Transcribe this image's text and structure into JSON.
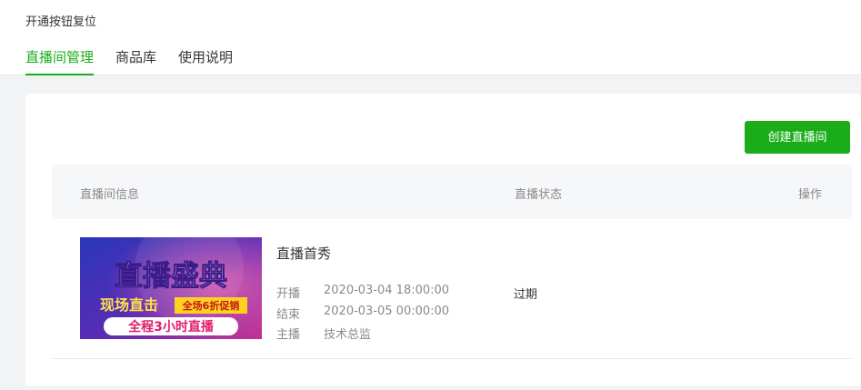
{
  "header": {
    "reset_label": "开通按钮复位",
    "tabs": [
      {
        "label": "直播间管理",
        "active": true
      },
      {
        "label": "商品库",
        "active": false
      },
      {
        "label": "使用说明",
        "active": false
      }
    ]
  },
  "toolbar": {
    "create_label": "创建直播间"
  },
  "table": {
    "columns": [
      "直播间信息",
      "直播状态",
      "操作"
    ],
    "rows": [
      {
        "title": "直播首秀",
        "start_label": "开播",
        "start_value": "2020-03-04 18:00:00",
        "end_label": "结束",
        "end_value": "2020-03-05 00:00:00",
        "host_label": "主播",
        "host_value": "技术总监",
        "status": "过期",
        "cover": {
          "line1": "直播盛典",
          "line2": "现场直击",
          "badge": "全场6折促销",
          "line3": "全程3小时直播"
        }
      }
    ]
  },
  "colors": {
    "accent": "#1aad19",
    "background": "#f2f3f5",
    "header_row": "#f6f7f9"
  }
}
